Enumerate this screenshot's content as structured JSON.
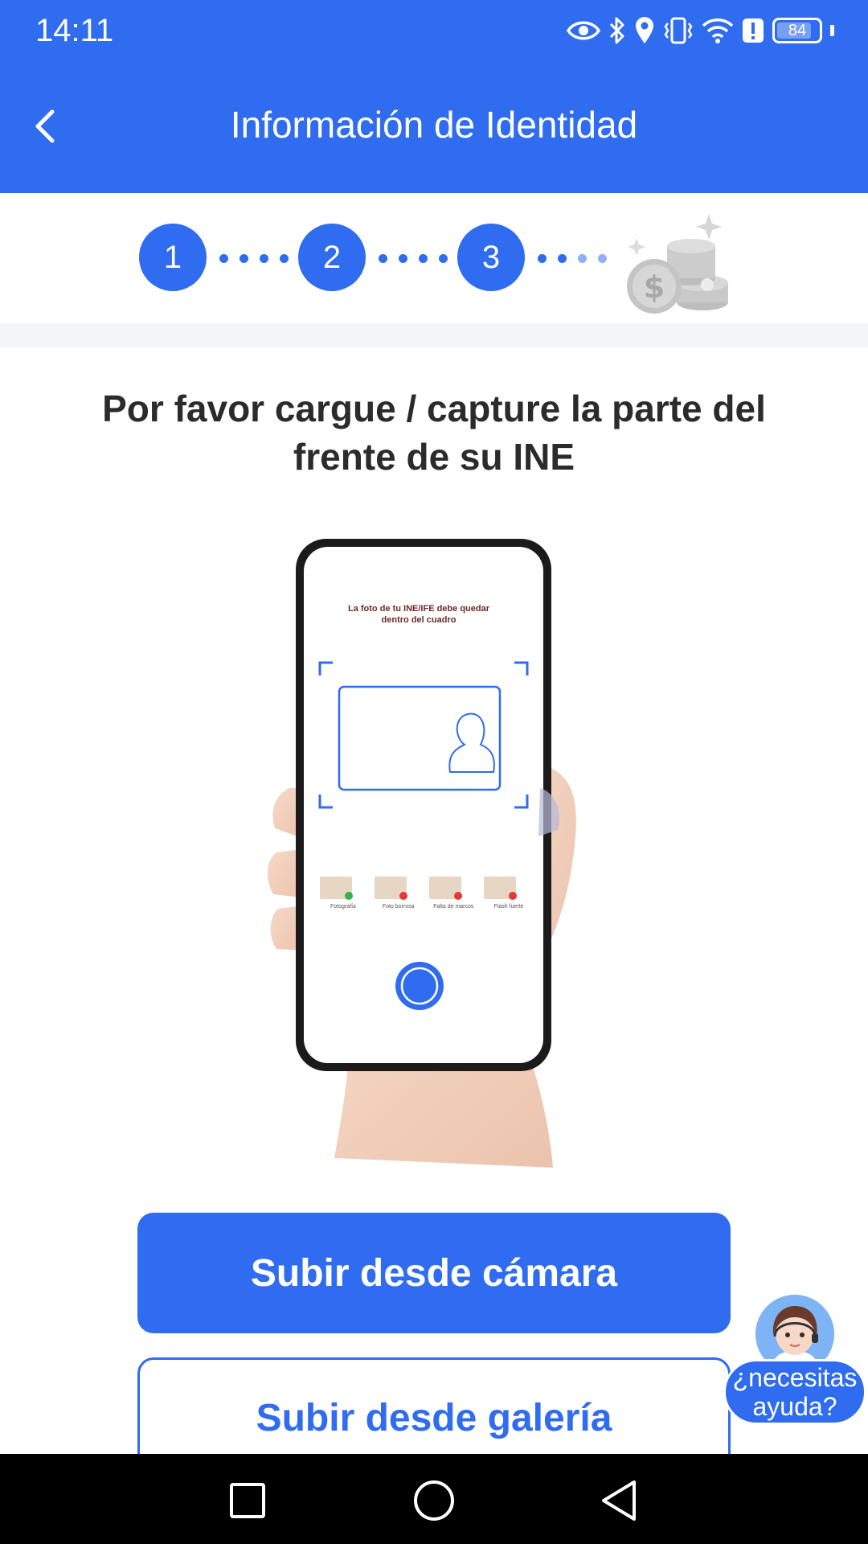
{
  "status_bar": {
    "time": "14:11",
    "battery": "84",
    "battery_level_percent": 84,
    "icons": [
      "eye-icon",
      "bluetooth-icon",
      "location-icon",
      "vibrate-icon",
      "wifi-icon",
      "alert-icon",
      "battery-icon"
    ]
  },
  "header": {
    "title": "Información de Identidad",
    "back_icon": "chevron-left-icon"
  },
  "steps": {
    "items": [
      "1",
      "2",
      "3"
    ],
    "current": 3,
    "final_icon": "coins-icon"
  },
  "main": {
    "instruction": "Por favor cargue / capture la parte del frente de su INE",
    "illustration": {
      "screen_text": "La foto de tu INE/IFE debe quedar dentro del cuadro",
      "examples": [
        "Fotografía",
        "Foto borrosa",
        "Falta de marcos",
        "Flash fuerte"
      ]
    }
  },
  "actions": {
    "camera_label": "Subir desde cámara",
    "gallery_label": "Subir desde galería"
  },
  "help": {
    "label": "¿necesitas ayuda?"
  },
  "colors": {
    "primary": "#2f6cf0",
    "background": "#ffffff",
    "text_dark": "#2b2b2b",
    "nav_bar": "#000000"
  }
}
